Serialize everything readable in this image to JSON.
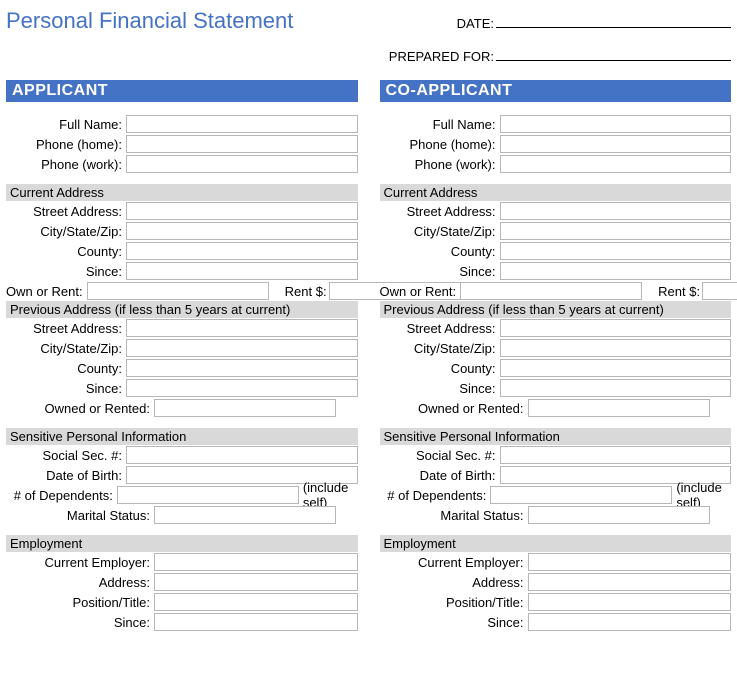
{
  "title": "Personal Financial Statement",
  "meta": {
    "date_label": "DATE:",
    "date_value": "",
    "prepared_for_label": "PREPARED FOR:",
    "prepared_for_value": ""
  },
  "applicant": {
    "header": "APPLICANT",
    "name_label": "Full Name:",
    "name": "",
    "phone_home_label": "Phone (home):",
    "phone_home": "",
    "phone_work_label": "Phone (work):",
    "phone_work": "",
    "addr": {
      "header": "Current Address",
      "street_label": "Street Address:",
      "street": "",
      "csz_label": "City/State/Zip:",
      "csz": "",
      "county_label": "County:",
      "county": "",
      "since_label": "Since:",
      "since": "",
      "own_rent_label": "Own or Rent:",
      "own_rent": "",
      "rent_label": "Rent $:",
      "rent": ""
    },
    "prev": {
      "header": "Previous Address (if less than 5 years at current)",
      "street_label": "Street Address:",
      "street": "",
      "csz_label": "City/State/Zip:",
      "csz": "",
      "county_label": "County:",
      "county": "",
      "since_label": "Since:",
      "since": "",
      "owned_rented_label": "Owned or Rented:",
      "owned_rented": ""
    },
    "sens": {
      "header": "Sensitive Personal Information",
      "ssn_label": "Social Sec. #:",
      "ssn": "",
      "dob_label": "Date of Birth:",
      "dob": "",
      "deps_label": "# of Dependents:",
      "deps": "",
      "deps_note": "(include self)",
      "marital_label": "Marital Status:",
      "marital": ""
    },
    "emp": {
      "header": "Employment",
      "employer_label": "Current Employer:",
      "employer": "",
      "address_label": "Address:",
      "address": "",
      "position_label": "Position/Title:",
      "position": "",
      "since_label": "Since:",
      "since": ""
    }
  },
  "coapplicant": {
    "header": "CO-APPLICANT",
    "name_label": "Full Name:",
    "name": "",
    "phone_home_label": "Phone (home):",
    "phone_home": "",
    "phone_work_label": "Phone (work):",
    "phone_work": "",
    "addr": {
      "header": "Current Address",
      "street_label": "Street Address:",
      "street": "",
      "csz_label": "City/State/Zip:",
      "csz": "",
      "county_label": "County:",
      "county": "",
      "since_label": "Since:",
      "since": "",
      "own_rent_label": "Own or Rent:",
      "own_rent": "",
      "rent_label": "Rent $:",
      "rent": ""
    },
    "prev": {
      "header": "Previous Address (if less than 5 years at current)",
      "street_label": "Street Address:",
      "street": "",
      "csz_label": "City/State/Zip:",
      "csz": "",
      "county_label": "County:",
      "county": "",
      "since_label": "Since:",
      "since": "",
      "owned_rented_label": "Owned or Rented:",
      "owned_rented": ""
    },
    "sens": {
      "header": "Sensitive Personal Information",
      "ssn_label": "Social Sec. #:",
      "ssn": "",
      "dob_label": "Date of Birth:",
      "dob": "",
      "deps_label": "# of Dependents:",
      "deps": "",
      "deps_note": "(include self)",
      "marital_label": "Marital Status:",
      "marital": ""
    },
    "emp": {
      "header": "Employment",
      "employer_label": "Current Employer:",
      "employer": "",
      "address_label": "Address:",
      "address": "",
      "position_label": "Position/Title:",
      "position": "",
      "since_label": "Since:",
      "since": ""
    }
  }
}
